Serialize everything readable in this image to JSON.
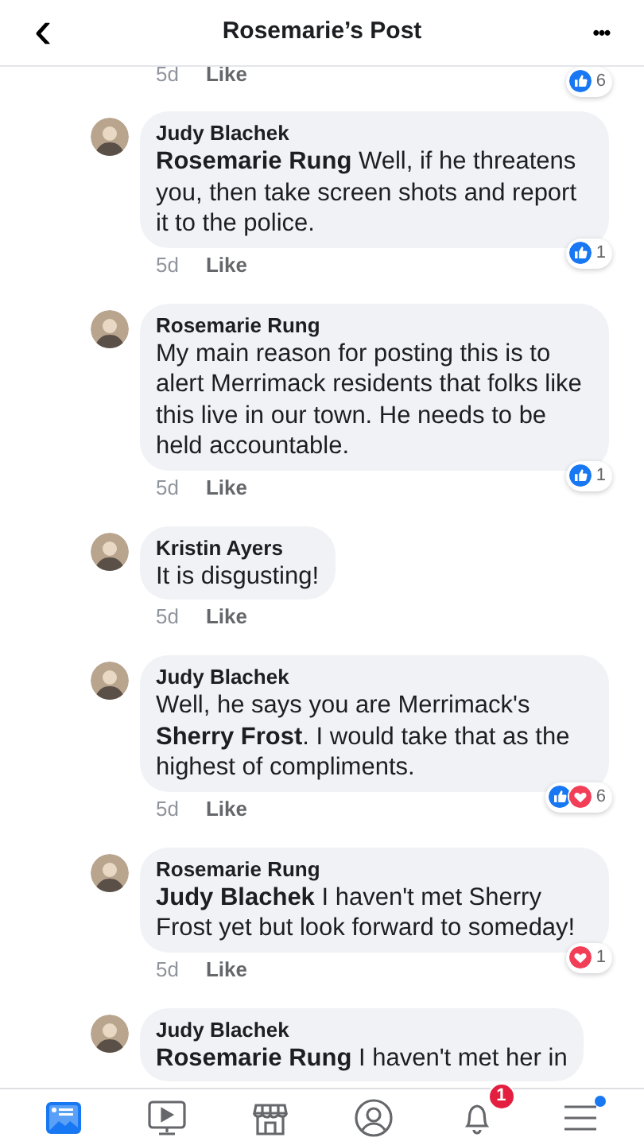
{
  "header": {
    "back": "‹",
    "title": "Rosemarie’s Post",
    "more": "•••"
  },
  "top_meta": {
    "time": "5d",
    "like": "Like",
    "reactions": [
      {
        "kind": "like"
      }
    ],
    "count": "6"
  },
  "comments": [
    {
      "author": "Judy Blachek",
      "text": "**Rosemarie Rung** Well, if he threatens you, then take screen shots and report it to the police.",
      "time": "5d",
      "like": "Like",
      "reactions": [
        {
          "kind": "like"
        }
      ],
      "count": "1"
    },
    {
      "author": "Rosemarie Rung",
      "text": "My main reason for posting this is to alert Merrimack residents that folks like this live in our town. He needs to be held accountable.",
      "time": "5d",
      "like": "Like",
      "reactions": [
        {
          "kind": "like"
        }
      ],
      "count": "1"
    },
    {
      "author": "Kristin Ayers",
      "text": "It is disgusting!",
      "time": "5d",
      "like": "Like"
    },
    {
      "author": "Judy Blachek",
      "text": "Well, he says you are Merrimack's **Sherry Frost**. I would take that as the highest of compliments.",
      "time": "5d",
      "like": "Like",
      "reactions": [
        {
          "kind": "like"
        },
        {
          "kind": "love"
        }
      ],
      "count": "6"
    },
    {
      "author": "Rosemarie Rung",
      "text": "**Judy Blachek** I haven't met Sherry Frost yet but look forward to someday!",
      "time": "5d",
      "like": "Like",
      "reactions": [
        {
          "kind": "love"
        }
      ],
      "count": "1"
    },
    {
      "author": "Judy Blachek",
      "text": "**Rosemarie Rung** I haven't met her in"
    }
  ],
  "tab_bar": [
    {
      "kind": "feed",
      "selected": true
    },
    {
      "kind": "video",
      "selected": false
    },
    {
      "kind": "marketplace",
      "selected": false
    },
    {
      "kind": "profile",
      "selected": false
    },
    {
      "kind": "notifications",
      "selected": false,
      "badge": "1"
    },
    {
      "kind": "menu",
      "selected": false,
      "dot": true
    }
  ]
}
